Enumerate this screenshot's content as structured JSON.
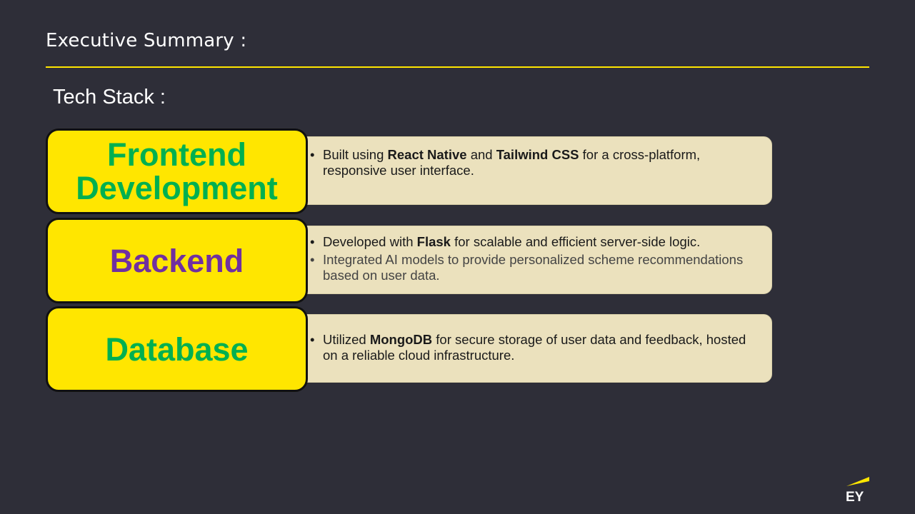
{
  "header": {
    "title": "Executive Summary :"
  },
  "subtitle": "Tech Stack :",
  "sections": [
    {
      "label_line1": "Frontend",
      "label_line2": "Development",
      "label_color": "#00b050",
      "bullets": [
        {
          "pre": "Built using ",
          "b1": "React Native",
          "mid": " and ",
          "b2": "Tailwind CSS",
          "post": " for a cross-platform, responsive user interface."
        }
      ]
    },
    {
      "label": "Backend",
      "label_color": "#7030a0",
      "bullets": [
        {
          "pre": "Developed with ",
          "b1": "Flask",
          "post": " for scalable and efficient server-side logic."
        },
        {
          "text": "Integrated AI models to provide personalized scheme recommendations based on user data."
        }
      ]
    },
    {
      "label": "Database",
      "label_color": "#00b050",
      "bullets": [
        {
          "pre": "Utilized ",
          "b1": "MongoDB",
          "post": " for secure storage of user data and feedback, hosted on a reliable cloud infrastructure."
        }
      ]
    }
  ],
  "bullet_glyph": "•",
  "logo": {
    "text": "EY",
    "icon": "ey-logo-icon",
    "accent": "#ffe600"
  },
  "colors": {
    "background": "#2e2e38",
    "accent": "#ffe600",
    "panel": "#ebe1bd"
  }
}
